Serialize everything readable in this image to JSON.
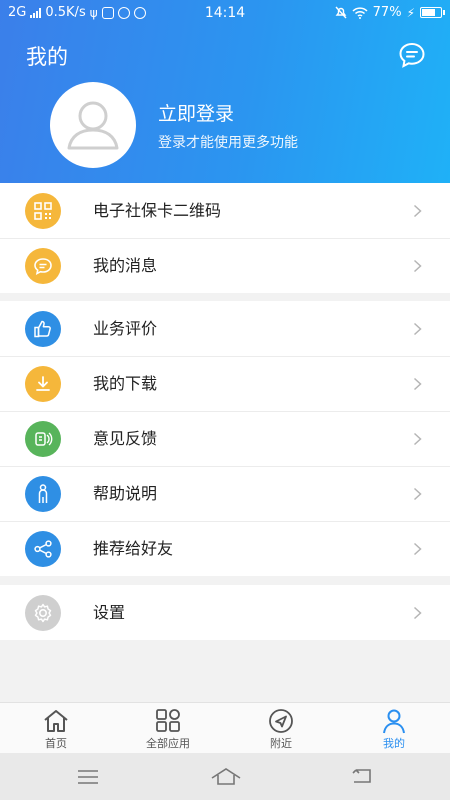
{
  "status_bar": {
    "network": "2G",
    "speed": "0.5K/s",
    "time": "14:14",
    "battery": "77%"
  },
  "header": {
    "title": "我的",
    "message_icon": "chat-bubble-icon",
    "login_title": "立即登录",
    "login_subtitle": "登录才能使用更多功能"
  },
  "menu_groups": [
    [
      {
        "label": "电子社保卡二维码",
        "icon": "qr-code-icon",
        "color": "#f5b73b"
      },
      {
        "label": "我的消息",
        "icon": "message-icon",
        "color": "#f5b73b"
      }
    ],
    [
      {
        "label": "业务评价",
        "icon": "thumbs-up-icon",
        "color": "#2f8fe4"
      },
      {
        "label": "我的下载",
        "icon": "download-icon",
        "color": "#f5b73b"
      },
      {
        "label": "意见反馈",
        "icon": "feedback-icon",
        "color": "#58b45b"
      },
      {
        "label": "帮助说明",
        "icon": "person-help-icon",
        "color": "#2f8fe4"
      },
      {
        "label": "推荐给好友",
        "icon": "share-icon",
        "color": "#2f8fe4"
      }
    ],
    [
      {
        "label": "设置",
        "icon": "gear-icon",
        "color": "#cfcfcf"
      }
    ]
  ],
  "tabbar": [
    {
      "label": "首页",
      "icon": "home-icon"
    },
    {
      "label": "全部应用",
      "icon": "apps-grid-icon"
    },
    {
      "label": "附近",
      "icon": "location-arrow-icon"
    },
    {
      "label": "我的",
      "icon": "person-icon",
      "active": true
    }
  ],
  "colors": {
    "header_start": "#3b7fea",
    "header_end": "#1fb1f7",
    "accent": "#2a8ff0"
  }
}
